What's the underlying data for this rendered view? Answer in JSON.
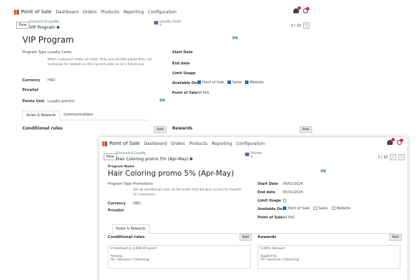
{
  "common": {
    "app_name": "Point of Sale",
    "nav": [
      "Dashboard",
      "Orders",
      "Products",
      "Reporting",
      "Configuration"
    ],
    "new_label": "New",
    "breadcrumb_parent": "Discount & Loyalty",
    "lang_badge": "EN",
    "labels": {
      "program_name": "Program Name",
      "program_type": "Program Type",
      "currency": "Currency",
      "pricelist": "Pricelist",
      "points_unit": "Points Unit",
      "start_date": "Start Date",
      "end_date": "End date",
      "limit_usage": "Limit Usage",
      "available_on": "Available On",
      "point_of_sale": "Point of Sale",
      "conditional_rules": "Conditional rules",
      "rewards": "Rewards",
      "add": "Add"
    },
    "available_options": [
      "Point of Sale",
      "Sales",
      "Website"
    ],
    "icons": {
      "bell": "bell-icon",
      "activity": "clock-icon",
      "settings": "gear-icon"
    },
    "colors": {
      "accent": "#1f7a7a",
      "checkbox": "#1f6fa8",
      "badge": "#e0264a"
    }
  },
  "window1": {
    "breadcrumb_current": "VIP Program",
    "smart_button": {
      "title": "Loyalty Cards",
      "count": "0"
    },
    "pager": "2 / 10",
    "title": "VIP Program",
    "program_type": "Loyalty Cards",
    "program_type_help": "When customers make an order, they accumulate points they can exchange for rewards on the current order or on a future one.",
    "currency": "HKD",
    "points_unit": "Loyalty point(s)",
    "start_date_label": "Start Date",
    "start_date": "",
    "end_date": "",
    "available_on_checked": [
      true,
      true,
      true
    ],
    "point_of_sale": "All PoS",
    "tabs": [
      "Rules & Rewards",
      "Communications"
    ]
  },
  "window2": {
    "breadcrumb_current": "Hair Coloring promo 5% (Apr-May)",
    "smart_button": {
      "title": "Promos",
      "count": "0"
    },
    "pager": "1 / 10",
    "title": "Hair Coloring promo 5% (Apr-May)",
    "program_type": "Promotions",
    "program_type_help": "Set up conditional rules on the order that will give access to rewards for customers",
    "currency": "HKD",
    "start_date_label": "Start Date",
    "start_date": "04/01/2024",
    "end_date": "05/31/2024",
    "available_on_checked": [
      true,
      false,
      false
    ],
    "point_of_sale": "All PoS",
    "tabs": [
      "Rules & Rewards"
    ],
    "rule": {
      "condition": "If minimum $ 2,000.00 spent",
      "among_label": "Among:",
      "among_value": "All / Services / Colouring"
    },
    "reward": {
      "discount": "5.00% discount",
      "applied_label": "Applied to:",
      "applied_value": "All / Services / Colouring"
    }
  }
}
